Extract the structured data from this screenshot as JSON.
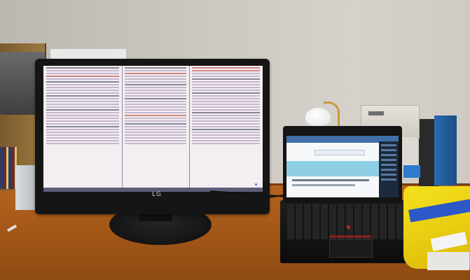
{
  "scene": {
    "monitor": {
      "brand": "LG",
      "panes": 3
    },
    "laptop": {
      "screen_theme_colors": [
        "#3f6fa6",
        "#8fcfe6",
        "#1b2a3d"
      ]
    },
    "colors": {
      "wall": "#cdc8c1",
      "desk": "#a75a18",
      "monitor_bezel": "#151515",
      "lamp_arm": "#c89a3a",
      "bag": "#e8cc10",
      "bag_stripe": "#2c58c8"
    }
  }
}
